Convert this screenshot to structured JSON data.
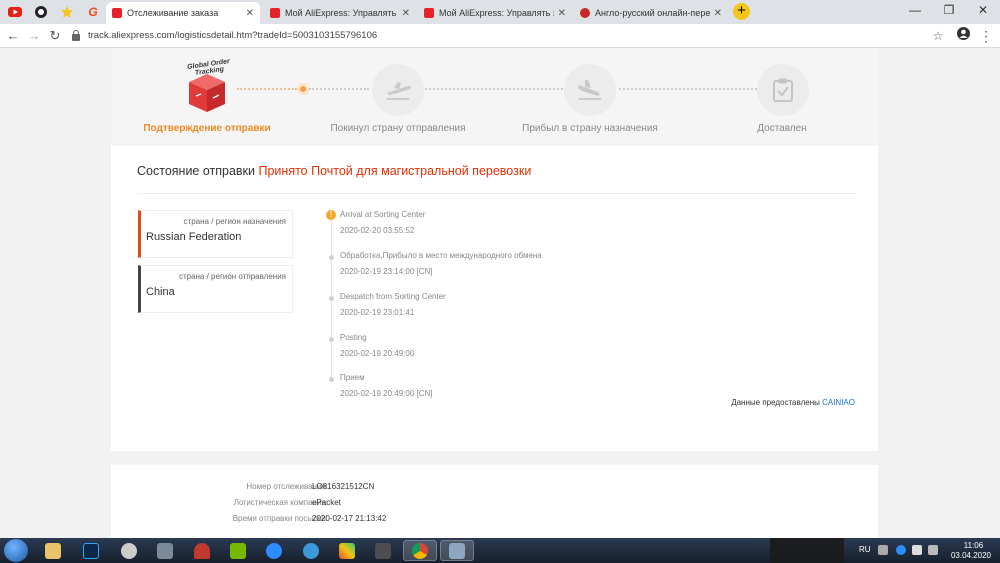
{
  "browser": {
    "tabs": [
      {
        "title": "Отслеживание заказа",
        "active": true
      },
      {
        "title": "Мой AliExpress: Управлять зака",
        "active": false
      },
      {
        "title": "Мой AliExpress: Управлять зака",
        "active": false
      },
      {
        "title": "Англо-русский онлайн-перевод",
        "active": false
      }
    ],
    "new_tab_label": "+",
    "url": "track.aliexpress.com/logisticsdetail.htm?tradeId=5003103155796106"
  },
  "tracking": {
    "global_tracking_text": "Global Order Tracking",
    "steps": [
      {
        "label": "Подтверждение отправки",
        "icon": "package-icon",
        "current": true
      },
      {
        "label": "Покинул страну отправления",
        "icon": "plane-departure-icon",
        "current": false
      },
      {
        "label": "Прибыл в страну назначения",
        "icon": "plane-arrival-icon",
        "current": false
      },
      {
        "label": "Доставлен",
        "icon": "clipboard-check-icon",
        "current": false
      }
    ],
    "status_label": "Состояние отправки",
    "status_value": "Принято Почтой для магистральной перевозки",
    "destination": {
      "label": "страна / регион назначения",
      "value": "Russian Federation"
    },
    "origin": {
      "label": "страна / регион отправления",
      "value": "China"
    },
    "events": [
      {
        "desc": "Arrival at Sorting Center",
        "time": "2020-02-20 03:55:52"
      },
      {
        "desc": "Обработка,Прибыло в место международного обмена",
        "time": "2020-02-19 23:14:00 [CN]"
      },
      {
        "desc": "Despatch from Sorting Center",
        "time": "2020-02-19 23:01:41"
      },
      {
        "desc": "Posting",
        "time": "2020-02-19 20:49:00"
      },
      {
        "desc": "Прием",
        "time": "2020-02-19 20:49:00 [CN]"
      }
    ],
    "provided_by_label": "Данные предоставлены",
    "provided_by_link": "CAINIAO"
  },
  "shipment_info": {
    "tracking_number_label": "Номер отслеживания:",
    "tracking_number": "LO816321512CN",
    "logistics_company_label": "Логистическая компания:",
    "logistics_company": "ePacket",
    "ship_time_label": "Время отправки посылки:",
    "ship_time": "2020-02-17 21:13:42"
  },
  "taskbar": {
    "language": "RU",
    "time": "11:06",
    "date": "03.04.2020"
  },
  "colors": {
    "accent_orange": "#f08a24",
    "status_red": "#e62e04",
    "link_blue": "#1a73c8"
  }
}
